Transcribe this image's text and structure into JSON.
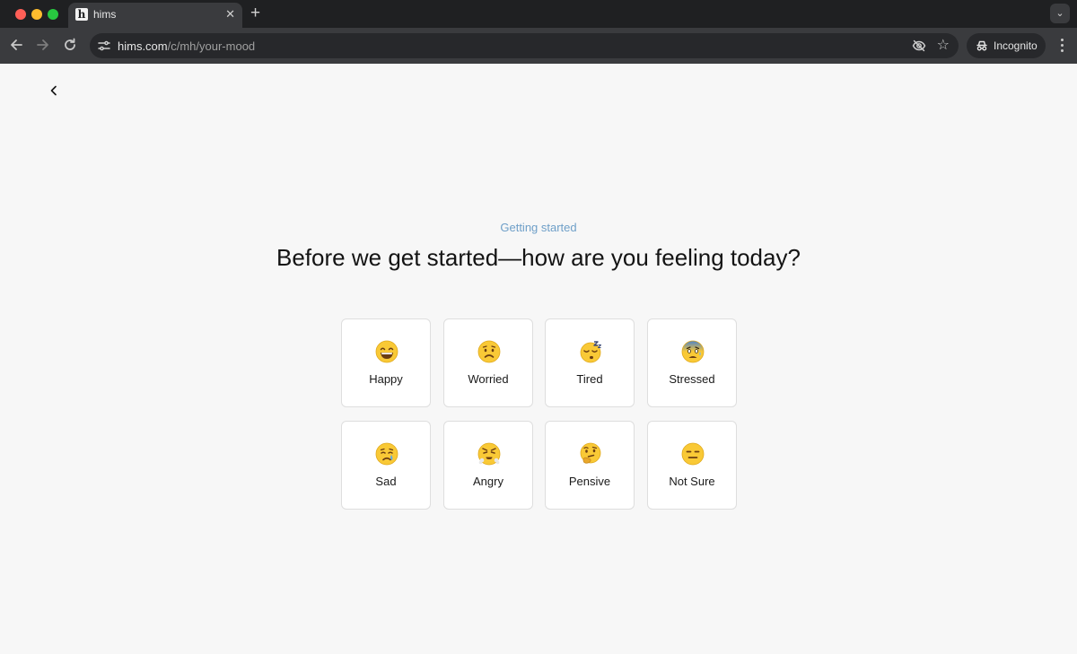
{
  "browser": {
    "tab": {
      "favicon_letter": "h",
      "title": "hims",
      "close_glyph": "✕"
    },
    "new_tab_glyph": "+",
    "tab_menu_glyph": "⌄",
    "address": {
      "host": "hims.com",
      "path": "/c/mh/your-mood"
    },
    "incognito_label": "Incognito",
    "icons": [
      "back-arrow-icon",
      "forward-arrow-icon",
      "reload-icon",
      "tune-icon",
      "eye-off-icon",
      "star-icon",
      "incognito-icon",
      "kebab-menu-icon"
    ]
  },
  "page": {
    "eyebrow": "Getting started",
    "headline": "Before we get started—how are you feeling today?",
    "moods": [
      {
        "label": "Happy",
        "icon": "happy-face-icon"
      },
      {
        "label": "Worried",
        "icon": "worried-face-icon"
      },
      {
        "label": "Tired",
        "icon": "sleeping-face-icon"
      },
      {
        "label": "Stressed",
        "icon": "anxious-face-icon"
      },
      {
        "label": "Sad",
        "icon": "crying-face-icon"
      },
      {
        "label": "Angry",
        "icon": "steaming-face-icon"
      },
      {
        "label": "Pensive",
        "icon": "thinking-face-icon"
      },
      {
        "label": "Not Sure",
        "icon": "neutral-face-icon"
      }
    ]
  },
  "colors": {
    "chrome_dark": "#1f2022",
    "toolbar": "#3a3b3e",
    "page_bg": "#f7f7f7",
    "eyebrow": "#6e9fc8",
    "emoji_yellow": "#f9c936"
  }
}
